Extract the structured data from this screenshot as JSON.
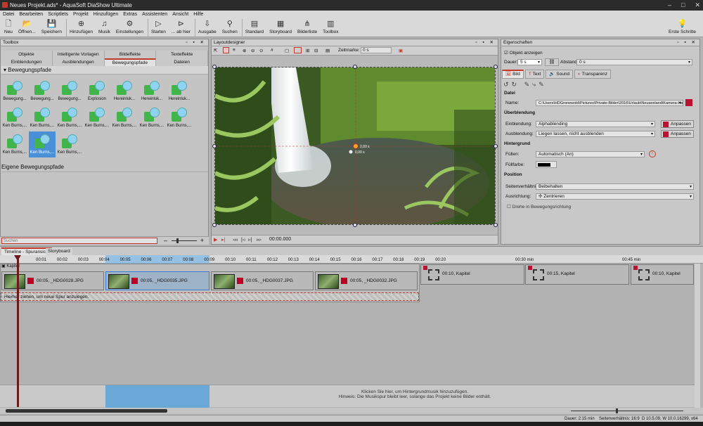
{
  "app": {
    "title": "Neues Projekt.ads* - AquaSoft DiaShow Ultimate",
    "window_controls": [
      "–",
      "□",
      "✕"
    ]
  },
  "menu": [
    "Datei",
    "Bearbeiten",
    "Scriptlets",
    "Projekt",
    "Hinzufügen",
    "Extras",
    "Assistenten",
    "Ansicht",
    "Hilfe"
  ],
  "toolbar": {
    "items": [
      {
        "label": "Neu",
        "icon": "new-icon",
        "glyph": "🗋"
      },
      {
        "label": "Öffnen...",
        "icon": "open-icon",
        "glyph": "📂"
      },
      {
        "label": "Speichern",
        "icon": "save-icon",
        "glyph": "💾"
      },
      {
        "label": "Hinzufügen",
        "icon": "add-icon",
        "glyph": "⊕"
      },
      {
        "label": "Musik",
        "icon": "music-icon",
        "glyph": "♫"
      },
      {
        "label": "Einstellungen",
        "icon": "settings-icon",
        "glyph": "⚙"
      },
      {
        "label": "Starten",
        "icon": "play-icon",
        "glyph": "▷"
      },
      {
        "label": "... ab hier",
        "icon": "play-from-here-icon",
        "glyph": "⊳"
      },
      {
        "label": "Ausgabe",
        "icon": "output-icon",
        "glyph": "⇩"
      },
      {
        "label": "Suchen",
        "icon": "search-icon",
        "glyph": "⚲"
      },
      {
        "label": "Standard",
        "icon": "standard-view-icon",
        "glyph": "▤"
      },
      {
        "label": "Storyboard",
        "icon": "storyboard-icon",
        "glyph": "▦"
      },
      {
        "label": "Bilderliste",
        "icon": "image-list-icon",
        "glyph": "⋔"
      },
      {
        "label": "Toolbox",
        "icon": "toolbox-icon",
        "glyph": "▥"
      }
    ],
    "first_steps": "Erste Schritte"
  },
  "toolbox": {
    "title": "Toolbox",
    "tabs_row1": [
      "Objekte",
      "Intelligente Vorlagen",
      "Bildeffekte",
      "Texteffekte"
    ],
    "tabs_row2": [
      "Einblendungen",
      "Ausblendungen",
      "Bewegungspfade",
      "Dateien"
    ],
    "active_tab": "Bewegungspfade",
    "section": "Bewegungspfade",
    "effects": [
      "Bewegung...",
      "Bewegung...",
      "Bewegung...",
      "Explosion",
      "Hereinluk...",
      "Hereinluk...",
      "Hereinluk...",
      "Ken Burns,...",
      "Ken Burns,...",
      "Ken Burns,...",
      "Ken Burns,...",
      "Ken Burns,...",
      "Ken Burns,...",
      "Ken Burns,...",
      "Ken Burns,...",
      "Ken Burns,...",
      "Ken Burns,..."
    ],
    "selected_index": 15,
    "own_section": "Eigene Bewegungspfade",
    "search_placeholder": "Suchen",
    "zoom_minus": "–",
    "zoom_plus": "+"
  },
  "layout": {
    "title": "Layoutdesigner",
    "zeitmarke_label": "Zeitmarke:",
    "zeitmarke_value": "0 s",
    "marker1": "2,00 s",
    "marker2": "0,00 s",
    "time": "00:00.000"
  },
  "props": {
    "title": "Eigenschaften",
    "show_object": "Objekt anzeigen",
    "dauer_label": "Dauer:",
    "dauer_value": "5 s",
    "abstand_label": "Abstand:",
    "abstand_value": "0 s",
    "tabs": [
      "Bild",
      "Text",
      "Sound",
      "Transparenz"
    ],
    "datei_header": "Datei",
    "name_label": "Name:",
    "name_value": "C:\\Users\\HDGronewold\\Pictures\\Private-Bilder\\2016\\Urlaub\\Neuseeland\\Kamera-Ha",
    "ueberblendung_header": "Überblendung",
    "einblendung_label": "Einblendung:",
    "einblendung_value": "Alphablending",
    "ausblendung_label": "Ausblendung:",
    "ausblendung_value": "Liegen lassen, nicht ausblenden",
    "anpassen": "Anpassen",
    "hintergrund_header": "Hintergrund",
    "fuellen_label": "Füllen:",
    "fuellen_value": "Automatisch (An)",
    "fuellfarbe_label": "Füllfarbe:",
    "position_header": "Position",
    "seiten_label": "Seitenverhältnis:",
    "seiten_value": "Beibehalten",
    "ausrichtung_label": "Ausrichtung:",
    "ausrichtung_value": "Zentrieren",
    "drehe": "Drehe in Bewegungsrichtung"
  },
  "timeline": {
    "tabs": [
      "Timeline - Spuransicht",
      "Storyboard"
    ],
    "ruler": [
      "00:01",
      "00:02",
      "00:03",
      "00:04",
      "00:05",
      "00:06",
      "00:07",
      "00:08",
      "00:09",
      "00:10",
      "00:11",
      "00:12",
      "00:13",
      "00:14",
      "00:15",
      "00:16",
      "00:17",
      "00:18",
      "00:19",
      "00:20"
    ],
    "ruler_right": [
      "00:30 min",
      "00:45 min"
    ],
    "chapter_label": "Kapitel",
    "clips": [
      {
        "label": "00:05, _HDG0028.JPG"
      },
      {
        "label": "00:05, _HDG0035.JPG"
      },
      {
        "label": "00:05, _HDG0037.JPG"
      },
      {
        "label": "00:05, _HDG0032.JPG"
      }
    ],
    "chapters": [
      {
        "label": "00:10, Kapitel"
      },
      {
        "label": "00:15, Kapitel"
      },
      {
        "label": "00:10, Kapitel"
      }
    ],
    "drop_hint": "Hierher ziehen, um neue Spur anzulegen.",
    "music_hint_1": "Klicken Sie hier, um Hintergrundmusik hinzuzufügen.",
    "music_hint_2": "Hinweis: Die Musikspur bleibt leer, solange das Projekt keine Bilder enthält."
  },
  "status": {
    "dauer": "Dauer: 2:15 min",
    "ratio": "Seitenverhältnis: 16:9",
    "version": "D 10.5.09, W 10.0.16299, x64"
  }
}
